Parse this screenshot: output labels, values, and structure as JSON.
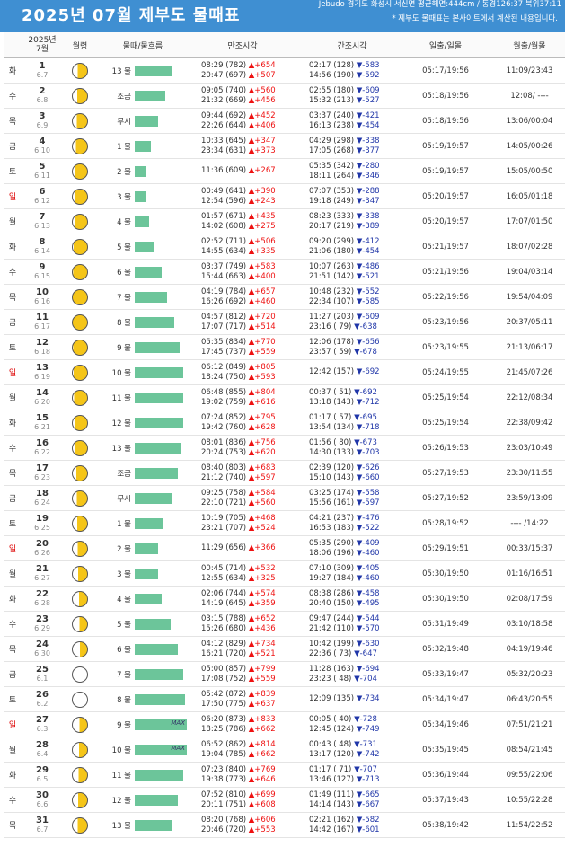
{
  "header": {
    "title": "2025년 07월 제부도 물때표",
    "location": "Jebudo 경기도 화성시 서신면 평균해면:444cm / 동경126:37 북위37:11",
    "note": "* 제부도 물때표는 본사이트에서 계산된 내용입니다."
  },
  "columns": {
    "date": "2025년\n7월",
    "moon": "월령",
    "flow": "물때/물흐름",
    "high": "만조시각",
    "low": "간조시각",
    "sun": "일출/일몰",
    "moonrise": "월출/월몰"
  },
  "colors": {
    "header_bg": "#3f8fd2",
    "bar": "#6cc59a",
    "rise": "#e11",
    "fall": "#2036a8",
    "sunday": "#d00"
  },
  "rows": [
    {
      "wd": "화",
      "date": "1",
      "lunar": "6.7",
      "phase": 0.3,
      "flow": "13 물",
      "bar": 42,
      "max": "",
      "high": [
        "08:29 (782) ▲+654",
        "20:47 (697) ▲+507"
      ],
      "low": [
        "02:17 (128) ▼-583",
        "14:56 (190) ▼-592"
      ],
      "sun": "05:17/19:56",
      "moon": "11:09/23:43"
    },
    {
      "wd": "수",
      "date": "2",
      "lunar": "6.8",
      "phase": 0.38,
      "flow": "조금",
      "bar": 34,
      "max": "",
      "high": [
        "09:05 (740) ▲+560",
        "21:32 (669) ▲+456"
      ],
      "low": [
        "02:55 (180) ▼-609",
        "15:32 (213) ▼-527"
      ],
      "sun": "05:18/19:56",
      "moon": "12:08/ ----"
    },
    {
      "wd": "목",
      "date": "3",
      "lunar": "6.9",
      "phase": 0.45,
      "flow": "무시",
      "bar": 26,
      "max": "",
      "high": [
        "09:44 (692) ▲+452",
        "22:26 (644) ▲+406"
      ],
      "low": [
        "03:37 (240) ▼-421",
        "16:13 (238) ▼-454"
      ],
      "sun": "05:18/19:56",
      "moon": "13:06/00:04"
    },
    {
      "wd": "금",
      "date": "4",
      "lunar": "6.10",
      "phase": 0.55,
      "flow": "1 물",
      "bar": 18,
      "max": "",
      "high": [
        "10:33 (645) ▲+347",
        "23:34 (631) ▲+373"
      ],
      "low": [
        "04:29 (298) ▼-338",
        "17:05 (268) ▼-377"
      ],
      "sun": "05:19/19:57",
      "moon": "14:05/00:26"
    },
    {
      "wd": "토",
      "date": "5",
      "lunar": "6.11",
      "phase": 0.62,
      "flow": "2 물",
      "bar": 12,
      "max": "",
      "high": [
        "11:36 (609) ▲+267"
      ],
      "low": [
        "05:35 (342) ▼-280",
        "18:11 (264) ▼-346"
      ],
      "sun": "05:19/19:57",
      "moon": "15:05/00:50"
    },
    {
      "wd": "일",
      "date": "6",
      "lunar": "6.12",
      "phase": 0.7,
      "flow": "3 물",
      "bar": 12,
      "max": "",
      "high": [
        "00:49 (641) ▲+390",
        "12:54 (596) ▲+243"
      ],
      "low": [
        "07:07 (353) ▼-288",
        "19:18 (249) ▼-347"
      ],
      "sun": "05:20/19:57",
      "moon": "16:05/01:18"
    },
    {
      "wd": "월",
      "date": "7",
      "lunar": "6.13",
      "phase": 0.78,
      "flow": "4 물",
      "bar": 16,
      "max": "",
      "high": [
        "01:57 (671) ▲+435",
        "14:02 (608) ▲+275"
      ],
      "low": [
        "08:23 (333) ▼-338",
        "20:17 (219) ▼-389"
      ],
      "sun": "05:20/19:57",
      "moon": "17:07/01:50"
    },
    {
      "wd": "화",
      "date": "8",
      "lunar": "6.14",
      "phase": 0.86,
      "flow": "5 물",
      "bar": 22,
      "max": "",
      "high": [
        "02:52 (711) ▲+506",
        "14:55 (634) ▲+335"
      ],
      "low": [
        "09:20 (299) ▼-412",
        "21:06 (180) ▼-454"
      ],
      "sun": "05:21/19:57",
      "moon": "18:07/02:28"
    },
    {
      "wd": "수",
      "date": "9",
      "lunar": "6.15",
      "phase": 0.93,
      "flow": "6 물",
      "bar": 30,
      "max": "",
      "high": [
        "03:37 (749) ▲+583",
        "15:44 (663) ▲+400"
      ],
      "low": [
        "10:07 (263) ▼-486",
        "21:51 (142) ▼-521"
      ],
      "sun": "05:21/19:56",
      "moon": "19:04/03:14"
    },
    {
      "wd": "목",
      "date": "10",
      "lunar": "6.16",
      "phase": 1.0,
      "flow": "7 물",
      "bar": 36,
      "max": "",
      "high": [
        "04:19 (784) ▲+657",
        "16:26 (692) ▲+460"
      ],
      "low": [
        "10:48 (232) ▼-552",
        "22:34 (107) ▼-585"
      ],
      "sun": "05:22/19:56",
      "moon": "19:54/04:09"
    },
    {
      "wd": "금",
      "date": "11",
      "lunar": "6.17",
      "phase": 1.0,
      "flow": "8 물",
      "bar": 44,
      "max": "",
      "high": [
        "04:57 (812) ▲+720",
        "17:07 (717) ▲+514"
      ],
      "low": [
        "11:27 (203) ▼-609",
        "23:16 ( 79) ▼-638"
      ],
      "sun": "05:23/19:56",
      "moon": "20:37/05:11"
    },
    {
      "wd": "토",
      "date": "12",
      "lunar": "6.18",
      "phase": 0.95,
      "flow": "9 물",
      "bar": 50,
      "max": "",
      "high": [
        "05:35 (834) ▲+770",
        "17:45 (737) ▲+559"
      ],
      "low": [
        "12:06 (178) ▼-656",
        "23:57 ( 59) ▼-678"
      ],
      "sun": "05:23/19:55",
      "moon": "21:13/06:17"
    },
    {
      "wd": "일",
      "date": "13",
      "lunar": "6.19",
      "phase": 0.88,
      "flow": "10 물",
      "bar": 54,
      "max": "",
      "high": [
        "06:12 (849) ▲+805",
        "18:24 (750) ▲+593"
      ],
      "low": [
        "12:42 (157) ▼-692"
      ],
      "sun": "05:24/19:55",
      "moon": "21:45/07:26"
    },
    {
      "wd": "월",
      "date": "14",
      "lunar": "6.20",
      "phase": 0.8,
      "flow": "11 물",
      "bar": 54,
      "max": "",
      "high": [
        "06:48 (855) ▲+804",
        "19:02 (759) ▲+616"
      ],
      "low": [
        "00:37 ( 51) ▼-692",
        "13:18 (143) ▼-712"
      ],
      "sun": "05:25/19:54",
      "moon": "22:12/08:34"
    },
    {
      "wd": "화",
      "date": "15",
      "lunar": "6.21",
      "phase": 0.72,
      "flow": "12 물",
      "bar": 54,
      "max": "",
      "high": [
        "07:24 (852) ▲+795",
        "19:42 (760) ▲+628"
      ],
      "low": [
        "01:17 ( 57) ▼-695",
        "13:54 (134) ▼-718"
      ],
      "sun": "05:25/19:54",
      "moon": "22:38/09:42"
    },
    {
      "wd": "수",
      "date": "16",
      "lunar": "6.22",
      "phase": 0.62,
      "flow": "13 물",
      "bar": 52,
      "max": "",
      "high": [
        "08:01 (836) ▲+756",
        "20:24 (753) ▲+620"
      ],
      "low": [
        "01:56 ( 80) ▼-673",
        "14:30 (133) ▼-703"
      ],
      "sun": "05:26/19:53",
      "moon": "23:03/10:49"
    },
    {
      "wd": "목",
      "date": "17",
      "lunar": "6.23",
      "phase": 0.52,
      "flow": "조금",
      "bar": 48,
      "max": "",
      "high": [
        "08:40 (803) ▲+683",
        "21:12 (740) ▲+597"
      ],
      "low": [
        "02:39 (120) ▼-626",
        "15:10 (143) ▼-660"
      ],
      "sun": "05:27/19:53",
      "moon": "23:30/11:55"
    },
    {
      "wd": "금",
      "date": "18",
      "lunar": "6.24",
      "phase": 0.45,
      "flow": "무시",
      "bar": 42,
      "max": "",
      "high": [
        "09:25 (758) ▲+584",
        "22:10 (721) ▲+560"
      ],
      "low": [
        "03:25 (174) ▼-558",
        "15:56 (161) ▼-597"
      ],
      "sun": "05:27/19:52",
      "moon": "23:59/13:09"
    },
    {
      "wd": "토",
      "date": "19",
      "lunar": "6.25",
      "phase": 0.38,
      "flow": "1 물",
      "bar": 32,
      "max": "",
      "high": [
        "10:19 (705) ▲+468",
        "23:21 (707) ▲+524"
      ],
      "low": [
        "04:21 (237) ▼-476",
        "16:53 (183) ▼-522"
      ],
      "sun": "05:28/19:52",
      "moon": "---- /14:22"
    },
    {
      "wd": "일",
      "date": "20",
      "lunar": "6.26",
      "phase": 0.3,
      "flow": "2 물",
      "bar": 26,
      "max": "",
      "high": [
        "11:29 (656) ▲+366"
      ],
      "low": [
        "05:35 (290) ▼-409",
        "18:06 (196) ▼-460"
      ],
      "sun": "05:29/19:51",
      "moon": "00:33/15:37"
    },
    {
      "wd": "월",
      "date": "21",
      "lunar": "6.27",
      "phase": 0.22,
      "flow": "3 물",
      "bar": 26,
      "max": "",
      "high": [
        "00:45 (714) ▲+532",
        "12:55 (634) ▲+325"
      ],
      "low": [
        "07:10 (309) ▼-405",
        "19:27 (184) ▼-460"
      ],
      "sun": "05:30/19:50",
      "moon": "01:16/16:51"
    },
    {
      "wd": "화",
      "date": "22",
      "lunar": "6.28",
      "phase": 0.15,
      "flow": "4 물",
      "bar": 30,
      "max": "",
      "high": [
        "02:06 (744) ▲+574",
        "14:19 (645) ▲+359"
      ],
      "low": [
        "08:38 (286) ▼-458",
        "20:40 (150) ▼-495"
      ],
      "sun": "05:30/19:50",
      "moon": "02:08/17:59"
    },
    {
      "wd": "수",
      "date": "23",
      "lunar": "6.29",
      "phase": 0.08,
      "flow": "5 물",
      "bar": 40,
      "max": "",
      "high": [
        "03:15 (788) ▲+652",
        "15:26 (680) ▲+436"
      ],
      "low": [
        "09:47 (244) ▼-544",
        "21:42 (110) ▼-570"
      ],
      "sun": "05:31/19:49",
      "moon": "03:10/18:58"
    },
    {
      "wd": "목",
      "date": "24",
      "lunar": "6.30",
      "phase": 0.03,
      "flow": "6 물",
      "bar": 48,
      "max": "",
      "high": [
        "04:12 (829) ▲+734",
        "16:21 (720) ▲+521"
      ],
      "low": [
        "10:42 (199) ▼-630",
        "22:36 ( 73) ▼-647"
      ],
      "sun": "05:32/19:48",
      "moon": "04:19/19:46"
    },
    {
      "wd": "금",
      "date": "25",
      "lunar": "6.1",
      "phase": 0.0,
      "flow": "7 물",
      "bar": 54,
      "max": "",
      "high": [
        "05:00 (857) ▲+799",
        "17:08 (752) ▲+559"
      ],
      "low": [
        "11:28 (163) ▼-694",
        "23:23 ( 48) ▼-704"
      ],
      "sun": "05:33/19:47",
      "moon": "05:32/20:23"
    },
    {
      "wd": "토",
      "date": "26",
      "lunar": "6.2",
      "phase": 0.02,
      "flow": "8 물",
      "bar": 56,
      "max": "",
      "high": [
        "05:42 (872) ▲+839",
        "17:50 (775) ▲+637"
      ],
      "low": [
        "12:09 (135) ▼-734"
      ],
      "sun": "05:34/19:47",
      "moon": "06:43/20:55"
    },
    {
      "wd": "일",
      "date": "27",
      "lunar": "6.3",
      "phase": 0.06,
      "flow": "9 물",
      "bar": 58,
      "max": "MAX",
      "high": [
        "06:20 (873) ▲+833",
        "18:25 (786) ▲+662"
      ],
      "low": [
        "00:05 ( 40) ▼-728",
        "12:45 (124) ▼-749"
      ],
      "sun": "05:34/19:46",
      "moon": "07:51/21:21"
    },
    {
      "wd": "월",
      "date": "28",
      "lunar": "6.4",
      "phase": 0.12,
      "flow": "10 물",
      "bar": 58,
      "max": "MAX",
      "high": [
        "06:52 (862) ▲+814",
        "19:04 (785) ▲+662"
      ],
      "low": [
        "00:43 ( 48) ▼-731",
        "13:17 (120) ▼-742"
      ],
      "sun": "05:35/19:45",
      "moon": "08:54/21:45"
    },
    {
      "wd": "화",
      "date": "29",
      "lunar": "6.5",
      "phase": 0.18,
      "flow": "11 물",
      "bar": 54,
      "max": "",
      "high": [
        "07:23 (840) ▲+769",
        "19:38 (773) ▲+646"
      ],
      "low": [
        "01:17 ( 71) ▼-707",
        "13:46 (127) ▼-713"
      ],
      "sun": "05:36/19:44",
      "moon": "09:55/22:06"
    },
    {
      "wd": "수",
      "date": "30",
      "lunar": "6.6",
      "phase": 0.24,
      "flow": "12 물",
      "bar": 48,
      "max": "",
      "high": [
        "07:52 (810) ▲+699",
        "20:11 (751) ▲+608"
      ],
      "low": [
        "01:49 (111) ▼-665",
        "14:14 (143) ▼-667"
      ],
      "sun": "05:37/19:43",
      "moon": "10:55/22:28"
    },
    {
      "wd": "목",
      "date": "31",
      "lunar": "6.7",
      "phase": 0.3,
      "flow": "13 물",
      "bar": 42,
      "max": "",
      "high": [
        "08:20 (768) ▲+606",
        "20:46 (720) ▲+553"
      ],
      "low": [
        "02:21 (162) ▼-582",
        "14:42 (167) ▼-601"
      ],
      "sun": "05:38/19:42",
      "moon": "11:54/22:52"
    }
  ]
}
